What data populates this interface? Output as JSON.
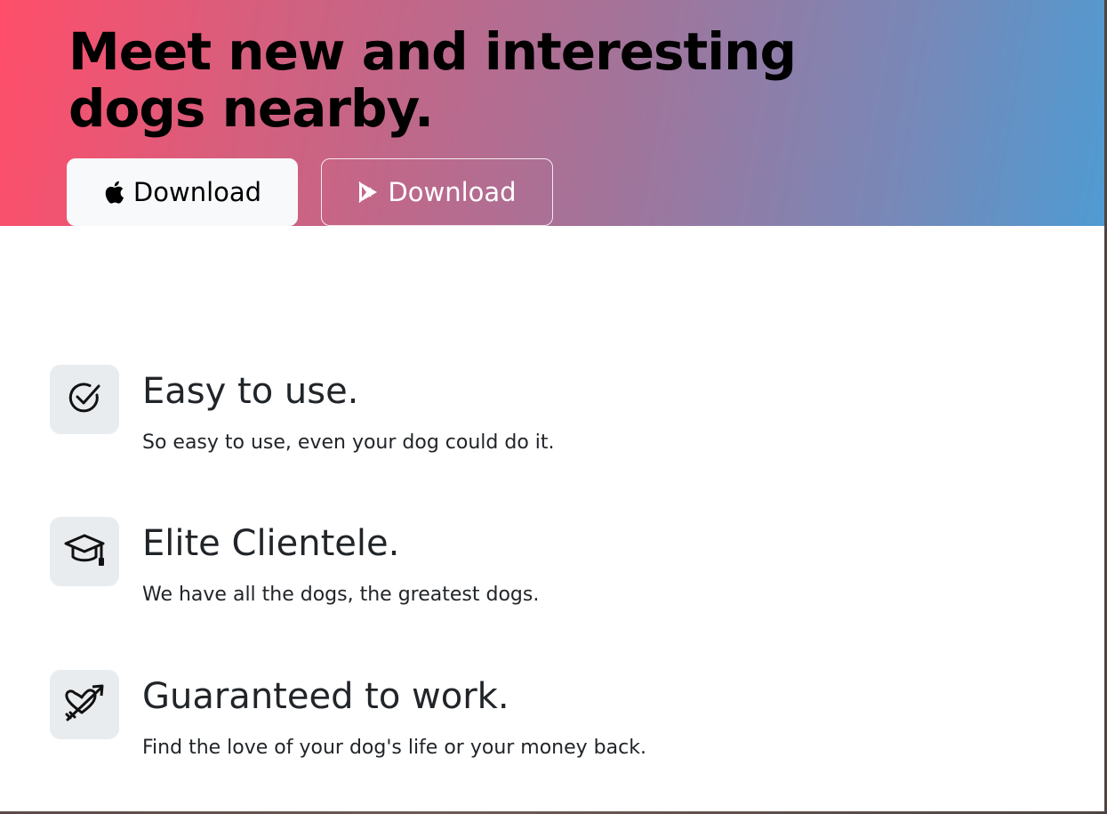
{
  "hero": {
    "title": "Meet new and interesting dogs nearby.",
    "apple_button_label": "Download",
    "play_button_label": "Download",
    "apple_icon": "apple-icon",
    "play_icon": "google-play-icon"
  },
  "features": [
    {
      "icon": "check-circle-icon",
      "title": "Easy to use.",
      "text": "So easy to use, even your dog could do it."
    },
    {
      "icon": "mortarboard-icon",
      "title": "Elite Clientele.",
      "text": "We have all the dogs, the greatest dogs."
    },
    {
      "icon": "heart-arrow-icon",
      "title": "Guaranteed to work.",
      "text": "Find the love of your dog's life or your money back."
    }
  ],
  "colors": {
    "hero_gradient_start": "#ff4e6a",
    "hero_gradient_end": "#4f9bd2",
    "feature_icon_bg": "#e9ecef"
  }
}
